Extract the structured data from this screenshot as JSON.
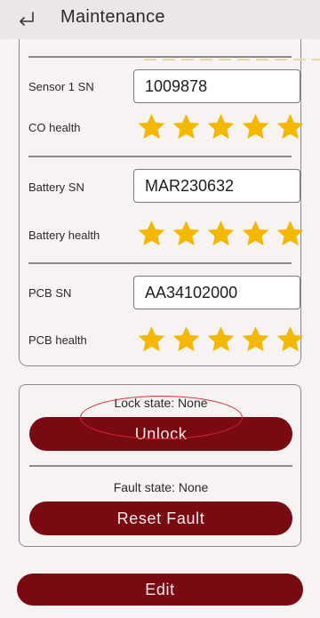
{
  "header": {
    "title": "Maintenance",
    "back_icon": "return-arrow-icon"
  },
  "colors": {
    "accent": "#7a0a12",
    "star": "#f5b800",
    "highlight": "#d8262e"
  },
  "rows": [
    {
      "label": "Sensor 1 SN",
      "value": "1009878"
    },
    {
      "label": "CO health",
      "rating": 5
    },
    {
      "label": "Battery SN",
      "value": "MAR230632"
    },
    {
      "label": "Battery health",
      "rating": 5
    },
    {
      "label": "PCB SN",
      "value": "AA34102000"
    },
    {
      "label": "PCB health",
      "rating": 5
    }
  ],
  "lock": {
    "state_text": "Lock state: None",
    "button": "Unlock"
  },
  "fault": {
    "state_text": "Fault state: None",
    "button": "Reset Fault"
  },
  "edit_button": "Edit"
}
